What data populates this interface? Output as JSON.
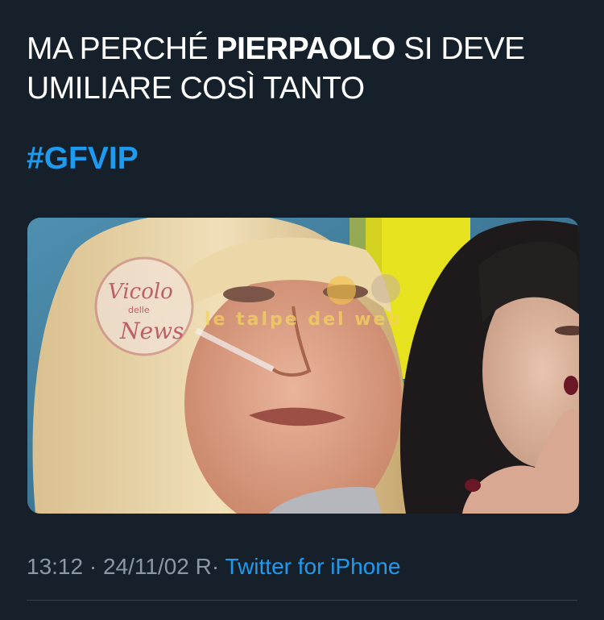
{
  "tweet": {
    "text_before": "MA PERCHÉ ",
    "text_bold": "PIERPAOLO",
    "text_after": " SI DEVE UMILIARE COSÌ TANTO",
    "hashtag": "#GFVIP"
  },
  "media": {
    "watermark_left_logo": "Vicolo delle News",
    "watermark_right_text": "le talpe del web"
  },
  "meta": {
    "time": "13:12",
    "date": "24/11/02",
    "suffix": "R",
    "separator": "·",
    "source": "Twitter for iPhone"
  },
  "colors": {
    "background": "#15202b",
    "link": "#1d9bf0",
    "muted": "#8b98a5"
  }
}
